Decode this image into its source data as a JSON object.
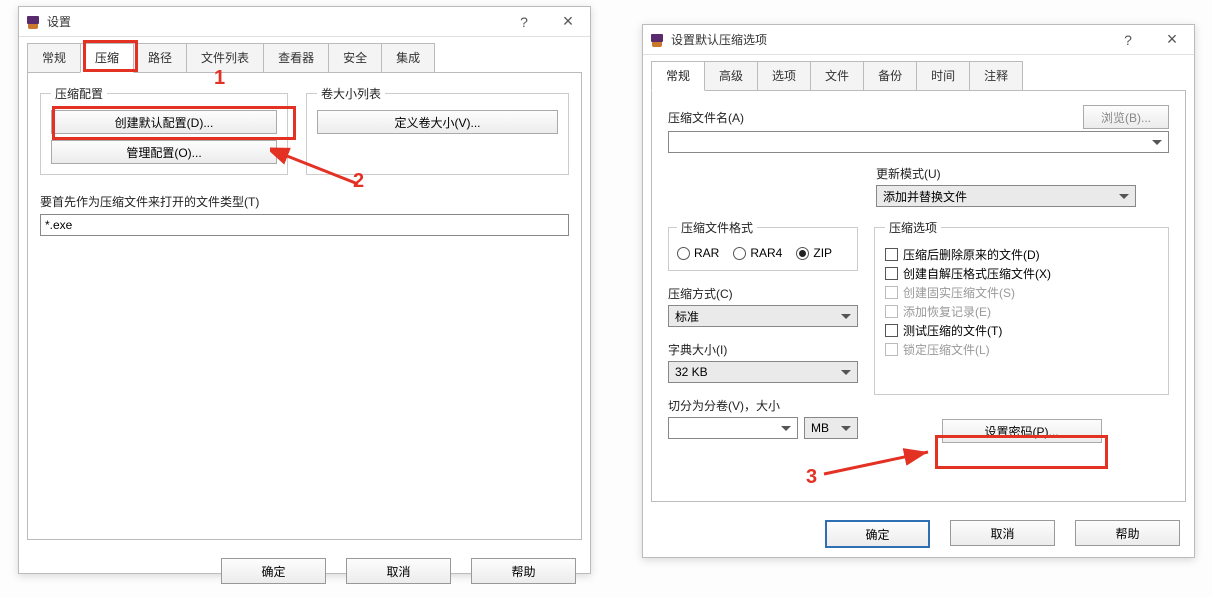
{
  "window1": {
    "title": "设置",
    "tabs": [
      "常规",
      "压缩",
      "路径",
      "文件列表",
      "查看器",
      "安全",
      "集成"
    ],
    "activeTabIndex": 1,
    "compressionProfile": {
      "legend": "压缩配置",
      "createDefault": "创建默认配置(D)...",
      "manageProfiles": "管理配置(O)..."
    },
    "volumeList": {
      "legend": "卷大小列表",
      "defineVolumes": "定义卷大小(V)..."
    },
    "openAsArchive": {
      "label": "要首先作为压缩文件来打开的文件类型(T)",
      "value": "*.exe"
    },
    "buttons": {
      "ok": "确定",
      "cancel": "取消",
      "help": "帮助"
    }
  },
  "window2": {
    "title": "设置默认压缩选项",
    "tabs": [
      "常规",
      "高级",
      "选项",
      "文件",
      "备份",
      "时间",
      "注释"
    ],
    "activeTabIndex": 0,
    "archiveName": {
      "label": "压缩文件名(A)",
      "browse": "浏览(B)..."
    },
    "updateMode": {
      "label": "更新模式(U)",
      "value": "添加并替换文件"
    },
    "format": {
      "legend": "压缩文件格式",
      "options": [
        "RAR",
        "RAR4",
        "ZIP"
      ],
      "selectedIndex": 2
    },
    "options": {
      "legend": "压缩选项",
      "items": [
        {
          "label": "压缩后删除原来的文件(D)",
          "checked": false,
          "disabled": false
        },
        {
          "label": "创建自解压格式压缩文件(X)",
          "checked": false,
          "disabled": false
        },
        {
          "label": "创建固实压缩文件(S)",
          "checked": false,
          "disabled": true
        },
        {
          "label": "添加恢复记录(E)",
          "checked": false,
          "disabled": true
        },
        {
          "label": "测试压缩的文件(T)",
          "checked": false,
          "disabled": false
        },
        {
          "label": "锁定压缩文件(L)",
          "checked": false,
          "disabled": true
        }
      ]
    },
    "method": {
      "label": "压缩方式(C)",
      "value": "标准"
    },
    "dict": {
      "label": "字典大小(I)",
      "value": "32 KB"
    },
    "split": {
      "label": "切分为分卷(V)，大小",
      "unit": "MB"
    },
    "setPassword": "设置密码(P)...",
    "buttons": {
      "ok": "确定",
      "cancel": "取消",
      "help": "帮助"
    }
  },
  "annotations": {
    "n1": "1",
    "n2": "2",
    "n3": "3"
  }
}
